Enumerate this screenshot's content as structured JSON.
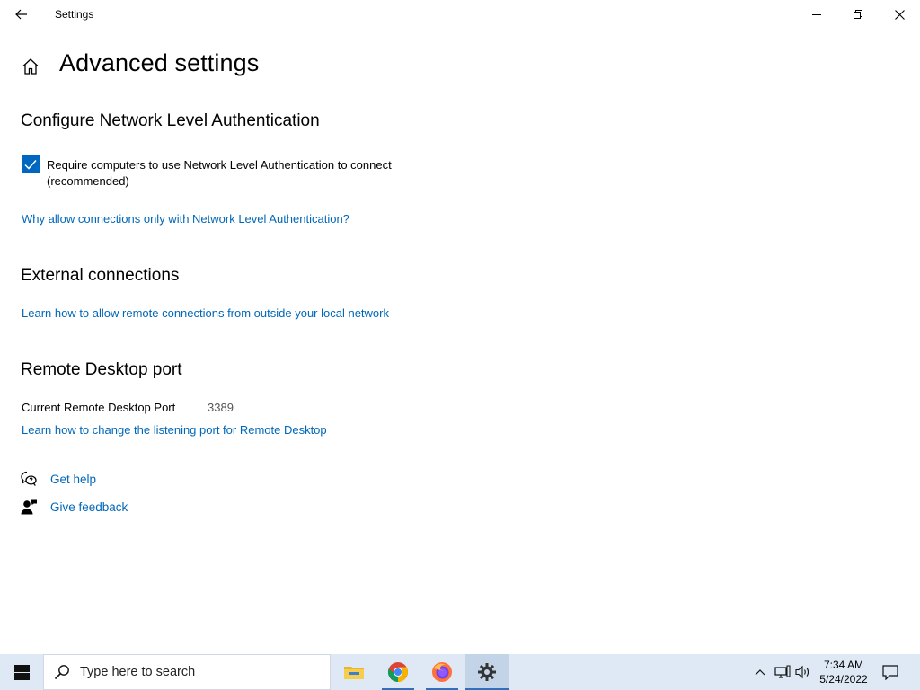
{
  "window": {
    "title": "Settings",
    "back_icon": "back-arrow-icon",
    "controls": [
      "minimize-icon",
      "restore-icon",
      "close-icon"
    ]
  },
  "page": {
    "title": "Advanced settings",
    "home_icon": "home-icon"
  },
  "nla": {
    "heading": "Configure Network Level Authentication",
    "checkbox_label": "Require computers to use Network Level Authentication to connect (recommended)",
    "checked": true,
    "link": "Why allow connections only with Network Level Authentication?"
  },
  "external": {
    "heading": "External connections",
    "link": "Learn how to allow remote connections from outside your local network"
  },
  "port": {
    "heading": "Remote Desktop port",
    "label": "Current Remote Desktop Port",
    "value": "3389",
    "link": "Learn how to change the listening port for Remote Desktop"
  },
  "help": {
    "get_help": "Get help",
    "give_feedback": "Give feedback"
  },
  "taskbar": {
    "search_placeholder": "Type here to search",
    "apps": [
      "file-explorer",
      "chrome",
      "firefox",
      "settings"
    ],
    "time": "7:34 AM",
    "date": "5/24/2022"
  },
  "colors": {
    "accent": "#0067c0",
    "link": "#0067b8",
    "taskbar": "#dfe9f5"
  }
}
